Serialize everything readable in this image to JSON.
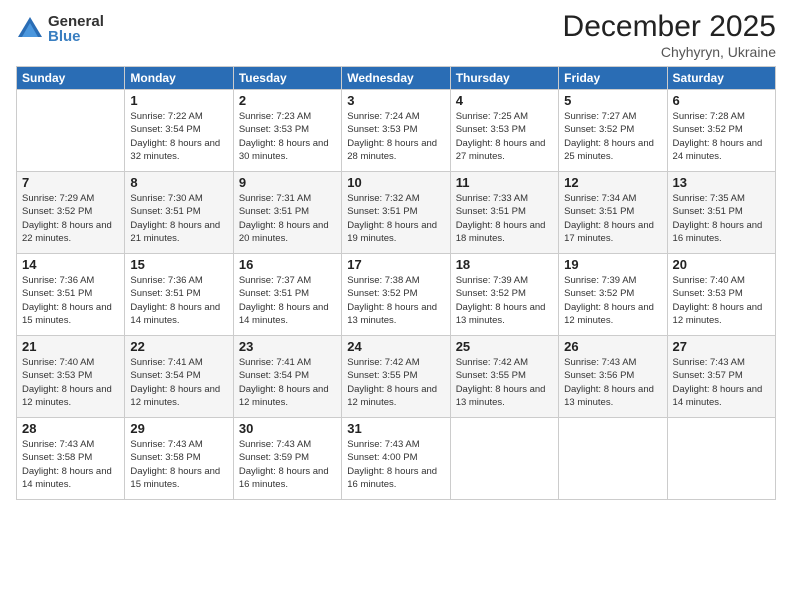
{
  "logo": {
    "general": "General",
    "blue": "Blue"
  },
  "header": {
    "month": "December 2025",
    "location": "Chyhyryn, Ukraine"
  },
  "weekdays": [
    "Sunday",
    "Monday",
    "Tuesday",
    "Wednesday",
    "Thursday",
    "Friday",
    "Saturday"
  ],
  "weeks": [
    [
      {
        "day": "",
        "sunrise": "",
        "sunset": "",
        "daylight": ""
      },
      {
        "day": "1",
        "sunrise": "Sunrise: 7:22 AM",
        "sunset": "Sunset: 3:54 PM",
        "daylight": "Daylight: 8 hours and 32 minutes."
      },
      {
        "day": "2",
        "sunrise": "Sunrise: 7:23 AM",
        "sunset": "Sunset: 3:53 PM",
        "daylight": "Daylight: 8 hours and 30 minutes."
      },
      {
        "day": "3",
        "sunrise": "Sunrise: 7:24 AM",
        "sunset": "Sunset: 3:53 PM",
        "daylight": "Daylight: 8 hours and 28 minutes."
      },
      {
        "day": "4",
        "sunrise": "Sunrise: 7:25 AM",
        "sunset": "Sunset: 3:53 PM",
        "daylight": "Daylight: 8 hours and 27 minutes."
      },
      {
        "day": "5",
        "sunrise": "Sunrise: 7:27 AM",
        "sunset": "Sunset: 3:52 PM",
        "daylight": "Daylight: 8 hours and 25 minutes."
      },
      {
        "day": "6",
        "sunrise": "Sunrise: 7:28 AM",
        "sunset": "Sunset: 3:52 PM",
        "daylight": "Daylight: 8 hours and 24 minutes."
      }
    ],
    [
      {
        "day": "7",
        "sunrise": "Sunrise: 7:29 AM",
        "sunset": "Sunset: 3:52 PM",
        "daylight": "Daylight: 8 hours and 22 minutes."
      },
      {
        "day": "8",
        "sunrise": "Sunrise: 7:30 AM",
        "sunset": "Sunset: 3:51 PM",
        "daylight": "Daylight: 8 hours and 21 minutes."
      },
      {
        "day": "9",
        "sunrise": "Sunrise: 7:31 AM",
        "sunset": "Sunset: 3:51 PM",
        "daylight": "Daylight: 8 hours and 20 minutes."
      },
      {
        "day": "10",
        "sunrise": "Sunrise: 7:32 AM",
        "sunset": "Sunset: 3:51 PM",
        "daylight": "Daylight: 8 hours and 19 minutes."
      },
      {
        "day": "11",
        "sunrise": "Sunrise: 7:33 AM",
        "sunset": "Sunset: 3:51 PM",
        "daylight": "Daylight: 8 hours and 18 minutes."
      },
      {
        "day": "12",
        "sunrise": "Sunrise: 7:34 AM",
        "sunset": "Sunset: 3:51 PM",
        "daylight": "Daylight: 8 hours and 17 minutes."
      },
      {
        "day": "13",
        "sunrise": "Sunrise: 7:35 AM",
        "sunset": "Sunset: 3:51 PM",
        "daylight": "Daylight: 8 hours and 16 minutes."
      }
    ],
    [
      {
        "day": "14",
        "sunrise": "Sunrise: 7:36 AM",
        "sunset": "Sunset: 3:51 PM",
        "daylight": "Daylight: 8 hours and 15 minutes."
      },
      {
        "day": "15",
        "sunrise": "Sunrise: 7:36 AM",
        "sunset": "Sunset: 3:51 PM",
        "daylight": "Daylight: 8 hours and 14 minutes."
      },
      {
        "day": "16",
        "sunrise": "Sunrise: 7:37 AM",
        "sunset": "Sunset: 3:51 PM",
        "daylight": "Daylight: 8 hours and 14 minutes."
      },
      {
        "day": "17",
        "sunrise": "Sunrise: 7:38 AM",
        "sunset": "Sunset: 3:52 PM",
        "daylight": "Daylight: 8 hours and 13 minutes."
      },
      {
        "day": "18",
        "sunrise": "Sunrise: 7:39 AM",
        "sunset": "Sunset: 3:52 PM",
        "daylight": "Daylight: 8 hours and 13 minutes."
      },
      {
        "day": "19",
        "sunrise": "Sunrise: 7:39 AM",
        "sunset": "Sunset: 3:52 PM",
        "daylight": "Daylight: 8 hours and 12 minutes."
      },
      {
        "day": "20",
        "sunrise": "Sunrise: 7:40 AM",
        "sunset": "Sunset: 3:53 PM",
        "daylight": "Daylight: 8 hours and 12 minutes."
      }
    ],
    [
      {
        "day": "21",
        "sunrise": "Sunrise: 7:40 AM",
        "sunset": "Sunset: 3:53 PM",
        "daylight": "Daylight: 8 hours and 12 minutes."
      },
      {
        "day": "22",
        "sunrise": "Sunrise: 7:41 AM",
        "sunset": "Sunset: 3:54 PM",
        "daylight": "Daylight: 8 hours and 12 minutes."
      },
      {
        "day": "23",
        "sunrise": "Sunrise: 7:41 AM",
        "sunset": "Sunset: 3:54 PM",
        "daylight": "Daylight: 8 hours and 12 minutes."
      },
      {
        "day": "24",
        "sunrise": "Sunrise: 7:42 AM",
        "sunset": "Sunset: 3:55 PM",
        "daylight": "Daylight: 8 hours and 12 minutes."
      },
      {
        "day": "25",
        "sunrise": "Sunrise: 7:42 AM",
        "sunset": "Sunset: 3:55 PM",
        "daylight": "Daylight: 8 hours and 13 minutes."
      },
      {
        "day": "26",
        "sunrise": "Sunrise: 7:43 AM",
        "sunset": "Sunset: 3:56 PM",
        "daylight": "Daylight: 8 hours and 13 minutes."
      },
      {
        "day": "27",
        "sunrise": "Sunrise: 7:43 AM",
        "sunset": "Sunset: 3:57 PM",
        "daylight": "Daylight: 8 hours and 14 minutes."
      }
    ],
    [
      {
        "day": "28",
        "sunrise": "Sunrise: 7:43 AM",
        "sunset": "Sunset: 3:58 PM",
        "daylight": "Daylight: 8 hours and 14 minutes."
      },
      {
        "day": "29",
        "sunrise": "Sunrise: 7:43 AM",
        "sunset": "Sunset: 3:58 PM",
        "daylight": "Daylight: 8 hours and 15 minutes."
      },
      {
        "day": "30",
        "sunrise": "Sunrise: 7:43 AM",
        "sunset": "Sunset: 3:59 PM",
        "daylight": "Daylight: 8 hours and 16 minutes."
      },
      {
        "day": "31",
        "sunrise": "Sunrise: 7:43 AM",
        "sunset": "Sunset: 4:00 PM",
        "daylight": "Daylight: 8 hours and 16 minutes."
      },
      {
        "day": "",
        "sunrise": "",
        "sunset": "",
        "daylight": ""
      },
      {
        "day": "",
        "sunrise": "",
        "sunset": "",
        "daylight": ""
      },
      {
        "day": "",
        "sunrise": "",
        "sunset": "",
        "daylight": ""
      }
    ]
  ]
}
